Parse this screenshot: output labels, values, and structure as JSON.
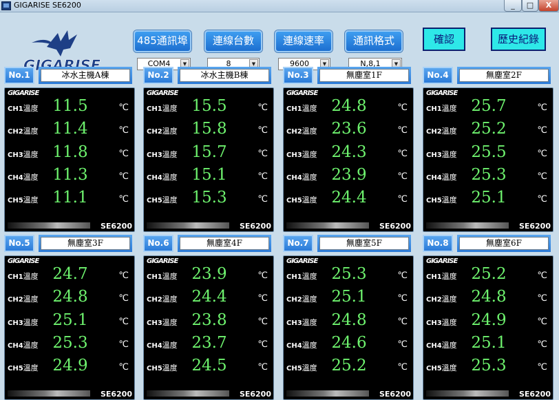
{
  "window": {
    "app": "GIGARISE",
    "title": "SE6200",
    "btn_min": "_",
    "btn_max": "□",
    "btn_close": "X"
  },
  "logo": {
    "text": "GIGARISE"
  },
  "config": {
    "buttons": [
      {
        "label": "485通訊埠",
        "value": "COM4"
      },
      {
        "label": "連線台數",
        "value": "8"
      },
      {
        "label": "連線速率",
        "value": "9600"
      },
      {
        "label": "通訊格式",
        "value": "N,8,1"
      }
    ],
    "dropdown_arrow": "▼"
  },
  "actions": {
    "confirm": "確認",
    "history": "歷史紀錄"
  },
  "panel_brand": "GIGARISE",
  "panel_model": "SE6200",
  "channel_suffix": "溫度",
  "unit": "℃",
  "panels": [
    {
      "no": "No.1",
      "name": "冰水主機A棟",
      "channels": [
        {
          "ch": "CH1",
          "value": "11.5"
        },
        {
          "ch": "CH2",
          "value": "11.4"
        },
        {
          "ch": "CH3",
          "value": "11.8"
        },
        {
          "ch": "CH4",
          "value": "11.3"
        },
        {
          "ch": "CH5",
          "value": "11.1"
        }
      ]
    },
    {
      "no": "No.2",
      "name": "冰水主機B棟",
      "channels": [
        {
          "ch": "CH1",
          "value": "15.5"
        },
        {
          "ch": "CH2",
          "value": "15.8"
        },
        {
          "ch": "CH3",
          "value": "15.7"
        },
        {
          "ch": "CH4",
          "value": "15.1"
        },
        {
          "ch": "CH5",
          "value": "15.3"
        }
      ]
    },
    {
      "no": "No.3",
      "name": "無塵室1F",
      "channels": [
        {
          "ch": "CH1",
          "value": "24.8"
        },
        {
          "ch": "CH2",
          "value": "23.6"
        },
        {
          "ch": "CH3",
          "value": "24.3"
        },
        {
          "ch": "CH4",
          "value": "23.9"
        },
        {
          "ch": "CH5",
          "value": "24.4"
        }
      ]
    },
    {
      "no": "No.4",
      "name": "無塵室2F",
      "channels": [
        {
          "ch": "CH1",
          "value": "25.7"
        },
        {
          "ch": "CH2",
          "value": "25.2"
        },
        {
          "ch": "CH3",
          "value": "25.5"
        },
        {
          "ch": "CH4",
          "value": "25.3"
        },
        {
          "ch": "CH5",
          "value": "25.1"
        }
      ]
    },
    {
      "no": "No.5",
      "name": "無塵室3F",
      "channels": [
        {
          "ch": "CH1",
          "value": "24.7"
        },
        {
          "ch": "CH2",
          "value": "24.8"
        },
        {
          "ch": "CH3",
          "value": "25.1"
        },
        {
          "ch": "CH4",
          "value": "25.3"
        },
        {
          "ch": "CH5",
          "value": "24.9"
        }
      ]
    },
    {
      "no": "No.6",
      "name": "無塵室4F",
      "channels": [
        {
          "ch": "CH1",
          "value": "23.9"
        },
        {
          "ch": "CH2",
          "value": "24.4"
        },
        {
          "ch": "CH3",
          "value": "23.8"
        },
        {
          "ch": "CH4",
          "value": "23.7"
        },
        {
          "ch": "CH5",
          "value": "24.5"
        }
      ]
    },
    {
      "no": "No.7",
      "name": "無塵室5F",
      "channels": [
        {
          "ch": "CH1",
          "value": "25.3"
        },
        {
          "ch": "CH2",
          "value": "25.1"
        },
        {
          "ch": "CH3",
          "value": "24.8"
        },
        {
          "ch": "CH4",
          "value": "24.6"
        },
        {
          "ch": "CH5",
          "value": "25.2"
        }
      ]
    },
    {
      "no": "No.8",
      "name": "無塵室6F",
      "channels": [
        {
          "ch": "CH1",
          "value": "25.2"
        },
        {
          "ch": "CH2",
          "value": "24.8"
        },
        {
          "ch": "CH3",
          "value": "24.9"
        },
        {
          "ch": "CH4",
          "value": "25.1"
        },
        {
          "ch": "CH5",
          "value": "25.3"
        }
      ]
    }
  ]
}
